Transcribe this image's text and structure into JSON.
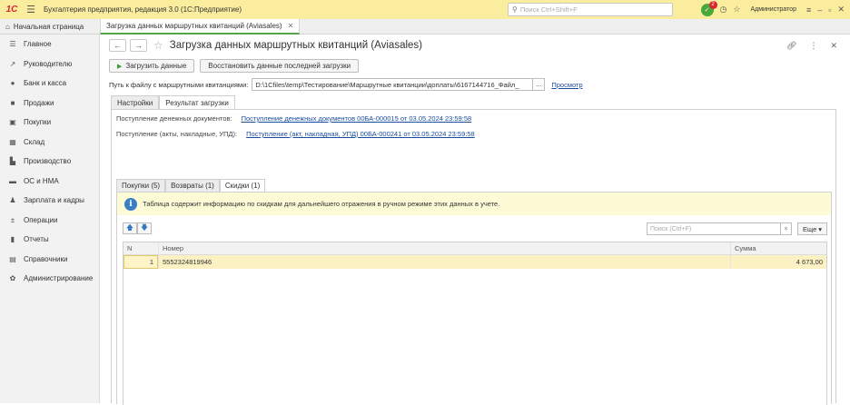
{
  "app": {
    "logo": "1С",
    "title": "Бухгалтерия предприятия, редакция 3.0  (1С:Предприятие)",
    "search_placeholder": "Поиск Ctrl+Shift+F",
    "notifications_count": "2",
    "user": "Администратор"
  },
  "tabs": {
    "home": "Начальная страница",
    "doc": "Загрузка данных маршрутных квитанций (Aviasales)"
  },
  "sidebar": {
    "items": [
      {
        "label": "Главное",
        "icon": "menu-icon"
      },
      {
        "label": "Руководителю",
        "icon": "chart-icon"
      },
      {
        "label": "Банк и касса",
        "icon": "coin-icon"
      },
      {
        "label": "Продажи",
        "icon": "bag-icon"
      },
      {
        "label": "Покупки",
        "icon": "cart-icon"
      },
      {
        "label": "Склад",
        "icon": "warehouse-icon"
      },
      {
        "label": "Производство",
        "icon": "factory-icon"
      },
      {
        "label": "ОС и НМА",
        "icon": "truck-icon"
      },
      {
        "label": "Зарплата и кадры",
        "icon": "person-icon"
      },
      {
        "label": "Операции",
        "icon": "operations-icon"
      },
      {
        "label": "Отчеты",
        "icon": "reports-icon"
      },
      {
        "label": "Справочники",
        "icon": "book-icon"
      },
      {
        "label": "Администрирование",
        "icon": "gear-icon"
      }
    ]
  },
  "form": {
    "title": "Загрузка данных маршрутных квитанций (Aviasales)",
    "load_button": "Загрузить данные",
    "restore_button": "Восстановить данные последней загрузки",
    "path_label": "Путь к файлу с маршрутными квитанциями:",
    "path_value": "D:\\1Cfiles\\temp\\Тестирование\\Маршрутные квитанции\\доплаты\\6167144716_Файл_",
    "path_button": "...",
    "browse_link": "Просмотр",
    "tabs": [
      "Настройки",
      "Результат загрузки"
    ],
    "cash_label": "Поступление денежных документов:",
    "cash_link": "Поступление денежных документов 00БА-000015 от 03.05.2024 23:59:58",
    "acts_label": "Поступление (акты, накладные, УПД):",
    "acts_link": "Поступление (акт, накладная, УПД) 00БА-000241 от 03.05.2024 23:59:58",
    "inner_tabs": [
      "Покупки (5)",
      "Возвраты (1)",
      "Скидки (1)"
    ],
    "info_text": "Таблица содержит информацию по скидкам для дальнейшего отражения в ручном режиме этих данных в учете.",
    "table_search_placeholder": "Поиск (Ctrl+F)",
    "table_search_clear": "×",
    "more_button": "Еще",
    "columns": [
      "N",
      "Номер",
      "Сумма"
    ],
    "rows": [
      {
        "n": "1",
        "number": "5552324819946",
        "sum": "4 673,00"
      }
    ]
  }
}
